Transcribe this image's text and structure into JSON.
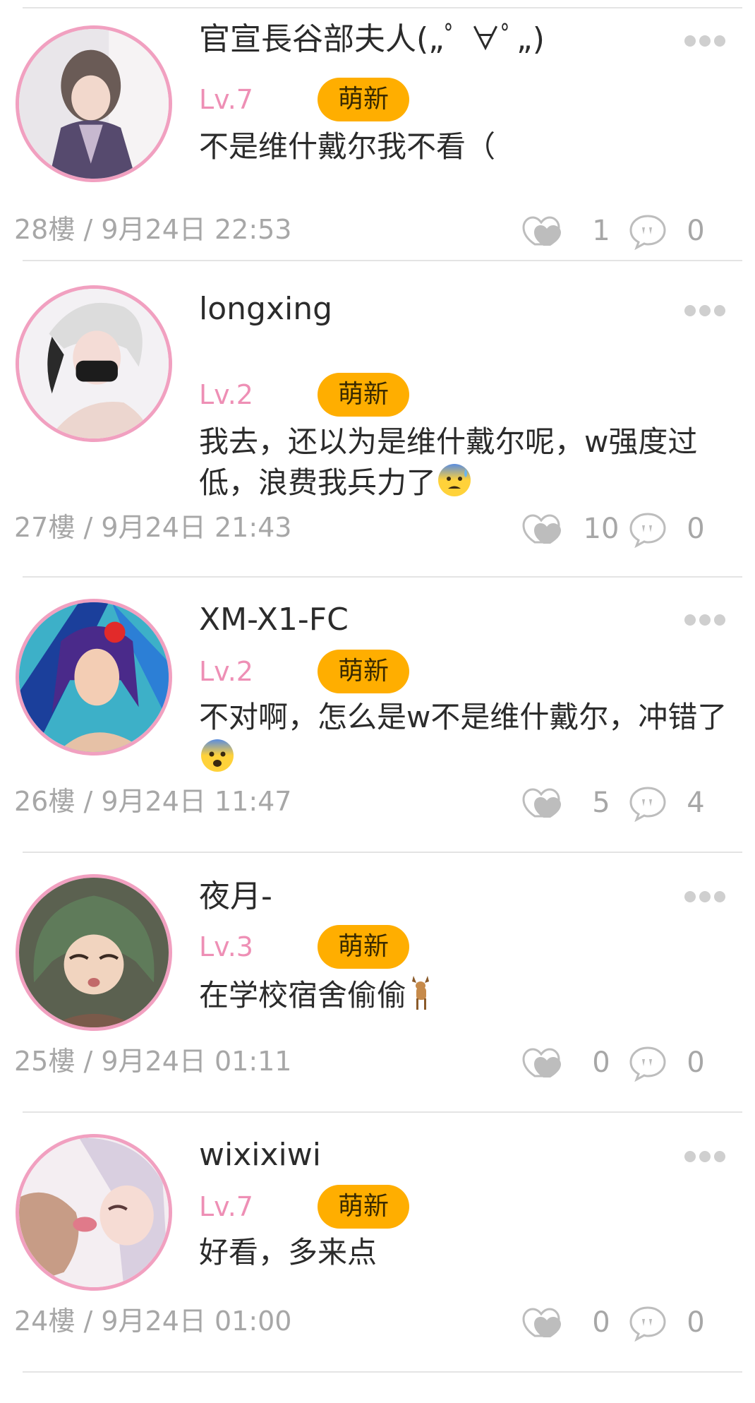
{
  "comments": [
    {
      "username": "官宣長谷部夫人(„ﾟ ∀ﾟ„)",
      "level": "Lv.7",
      "badge": "萌新",
      "text": "不是维什戴尔我不看（",
      "floor": "28樓",
      "datetime": "9月24日 22:53",
      "likes": "1",
      "replies": "0"
    },
    {
      "username": "longxing",
      "level": "Lv.2",
      "badge": "萌新",
      "text": "我去，还以为是维什戴尔呢，w强度过低，浪费我兵力了",
      "emoji": "anxious-sweat-face",
      "floor": "27樓",
      "datetime": "9月24日 21:43",
      "likes": "10",
      "replies": "0"
    },
    {
      "username": "XM-X1-FC",
      "level": "Lv.2",
      "badge": "萌新",
      "text": "不对啊，怎么是w不是维什戴尔，冲错了",
      "emoji": "fearful-face",
      "floor": "26樓",
      "datetime": "9月24日 11:47",
      "likes": "5",
      "replies": "4"
    },
    {
      "username": "夜月-",
      "level": "Lv.3",
      "badge": "萌新",
      "text": "在学校宿舍偷偷",
      "emoji": "deer",
      "floor": "25樓",
      "datetime": "9月24日 01:11",
      "likes": "0",
      "replies": "0"
    },
    {
      "username": "wixixiwi",
      "level": "Lv.7",
      "badge": "萌新",
      "text": "好看，多来点",
      "floor": "24樓",
      "datetime": "9月24日 01:00",
      "likes": "0",
      "replies": "0"
    }
  ],
  "separator": "/",
  "icons": {
    "like": "heart-outline-icon",
    "reply": "speech-bubble-icon",
    "more": "more-dots-icon"
  },
  "colors": {
    "badge": "#ffae00",
    "level": "#ee8fb5",
    "avatar_border": "#f1a0c0",
    "meta": "#a7a7a7"
  }
}
